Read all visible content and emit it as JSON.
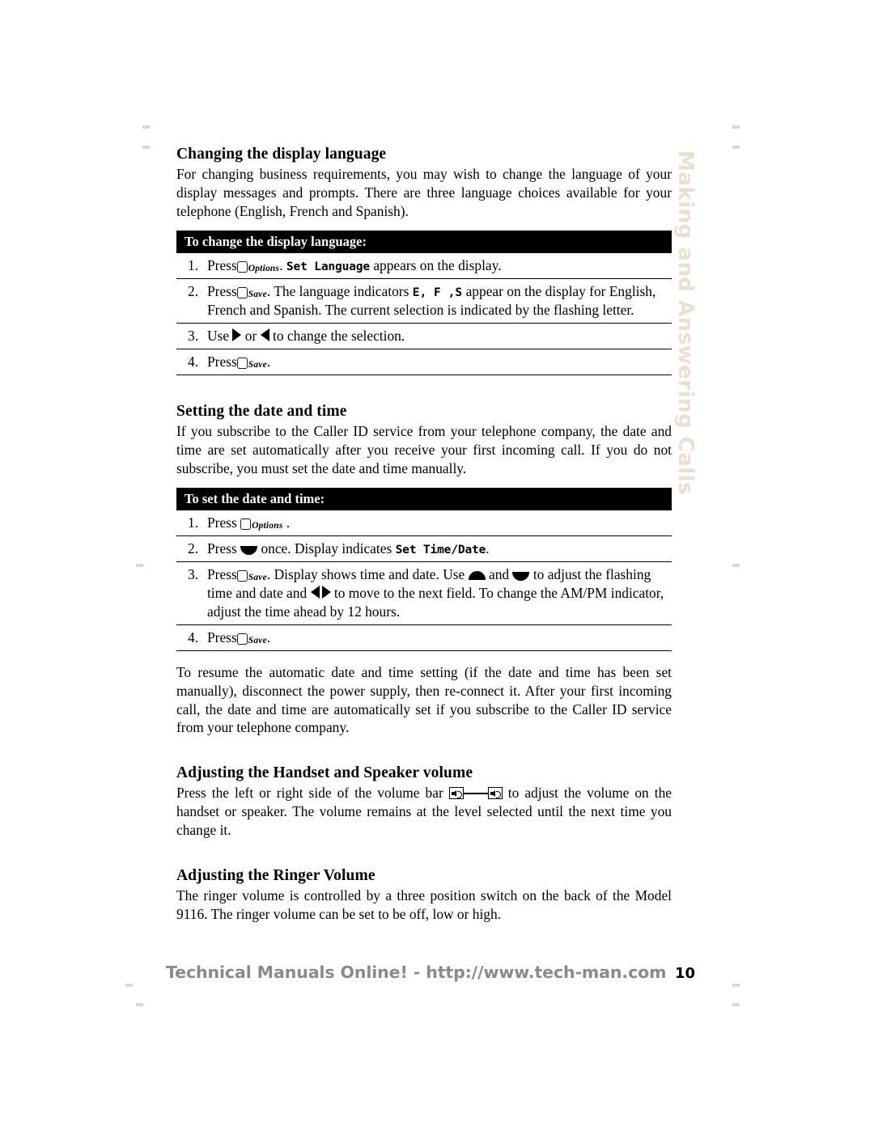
{
  "page": {
    "number": "10",
    "side_tab": "Making and Answering Calls",
    "side_tab_color": "#e9e0d2"
  },
  "sections": {
    "display_language": {
      "title": "Changing the display language",
      "intro": "For changing business requirements, you may wish to change the language of your display messages and prompts. There are three language choices available for your telephone (English, French and Spanish).",
      "proc_header": "To change the display language:",
      "steps": [
        {
          "num": "1.",
          "press_label": "Press",
          "key": "Options",
          "text_after": ".",
          "lcd": "Set Language",
          "tail": "appears on the display."
        },
        {
          "num": "2.",
          "press_label": "Press",
          "key": "Save",
          "text_after": ". The language indicators",
          "indicators": "E, F ,S",
          "tail": "appear on the display for English, French and Spanish.  The current selection is indicated by the flashing letter."
        },
        {
          "num": "3.",
          "lead": "Use",
          "mid": "or",
          "tail": "to change the selection."
        },
        {
          "num": "4.",
          "press_label": "Press",
          "key": "Save",
          "text_after": "."
        }
      ]
    },
    "date_and_time": {
      "title": "Setting the date and time",
      "intro": "If you subscribe to the Caller ID service from your telephone company, the date and time are set automatically after you receive your first incoming call. If you do not subscribe, you must set the date and time manually.",
      "proc_header": "To set the date and time:",
      "steps": [
        {
          "num": "1.",
          "press_label": "Press",
          "key": "Options",
          "text_after": "."
        },
        {
          "num": "2.",
          "press_label": "Press",
          "mid": "once. Display indicates",
          "lcd": "Set Time/Date",
          "tail": "."
        },
        {
          "num": "3.",
          "press_label": "Press",
          "key": "Save",
          "text_after": ". Display shows time and date.  Use",
          "mid_and": "and",
          "mid2": "to adjust the flashing time and date and",
          "mid3": "to move to the next field.  To change the AM/PM indicator, adjust the time ahead by 12 hours."
        },
        {
          "num": "4.",
          "press_label": "Press",
          "key": "Save",
          "text_after": "."
        }
      ],
      "outro": "To resume the automatic date and time setting (if the date and time has been set manually), disconnect the power supply, then re-connect it. After your first incoming call, the date and time are automatically set if you subscribe to the Caller ID service from your telephone company."
    },
    "handset_speaker_volume": {
      "title": "Adjusting the Handset and Speaker volume",
      "text_before": "Press the left or right side of the volume bar",
      "text_after": "to adjust the volume on the handset or speaker.  The volume remains at the level selected until the next time you change it."
    },
    "ringer_volume": {
      "title": "Adjusting the Ringer Volume",
      "text": "The ringer volume is controlled by a three position switch on the back of the Model 9116.  The ringer volume can be set to be off, low or high."
    }
  },
  "footer": {
    "url": "Technical Manuals Online! - http://www.tech-man.com",
    "page_number": "10"
  }
}
